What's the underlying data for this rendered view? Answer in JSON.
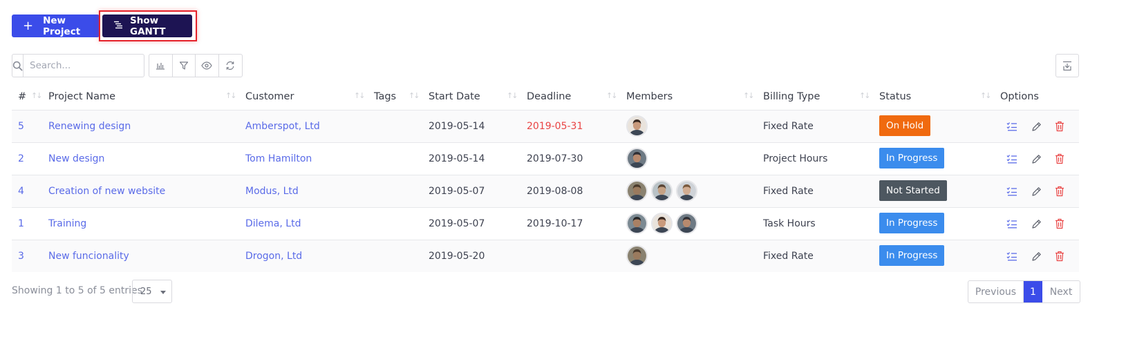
{
  "actions": {
    "new_project": "New Project",
    "show_gantt": "Show GANTT"
  },
  "search": {
    "placeholder": "Search..."
  },
  "columns": [
    "#",
    "Project Name",
    "Customer",
    "Tags",
    "Start Date",
    "Deadline",
    "Members",
    "Billing Type",
    "Status",
    "Options"
  ],
  "rows": [
    {
      "id": "5",
      "name": "Renewing design",
      "customer": "Amberspot, Ltd",
      "tags": "",
      "start": "2019-05-14",
      "deadline": "2019-05-31",
      "deadline_overdue": true,
      "members": 1,
      "billing": "Fixed Rate",
      "status": "On Hold",
      "status_color": "#f06a0f"
    },
    {
      "id": "2",
      "name": "New design",
      "customer": "Tom Hamilton",
      "tags": "",
      "start": "2019-05-14",
      "deadline": "2019-07-30",
      "deadline_overdue": false,
      "members": 1,
      "billing": "Project Hours",
      "status": "In Progress",
      "status_color": "#3b8ced"
    },
    {
      "id": "4",
      "name": "Creation of new website",
      "customer": "Modus, Ltd",
      "tags": "",
      "start": "2019-05-07",
      "deadline": "2019-08-08",
      "deadline_overdue": false,
      "members": 3,
      "billing": "Fixed Rate",
      "status": "Not Started",
      "status_color": "#4d5760"
    },
    {
      "id": "1",
      "name": "Training",
      "customer": "Dilema, Ltd",
      "tags": "",
      "start": "2019-05-07",
      "deadline": "2019-10-17",
      "deadline_overdue": false,
      "members": 3,
      "billing": "Task Hours",
      "status": "In Progress",
      "status_color": "#3b8ced"
    },
    {
      "id": "3",
      "name": "New funcionality",
      "customer": "Drogon, Ltd",
      "tags": "",
      "start": "2019-05-20",
      "deadline": "",
      "deadline_overdue": false,
      "members": 1,
      "billing": "Fixed Rate",
      "status": "In Progress",
      "status_color": "#3b8ced"
    }
  ],
  "footer": {
    "info": "Showing 1 to 5 of 5 entries",
    "page_length": "25",
    "previous": "Previous",
    "current_page": "1",
    "next": "Next"
  },
  "colors": {
    "primary": "#3b4ce9",
    "gantt": "#1d1453",
    "link": "#5a6be8",
    "overdue": "#e94343",
    "highlight": "#e5222a"
  }
}
